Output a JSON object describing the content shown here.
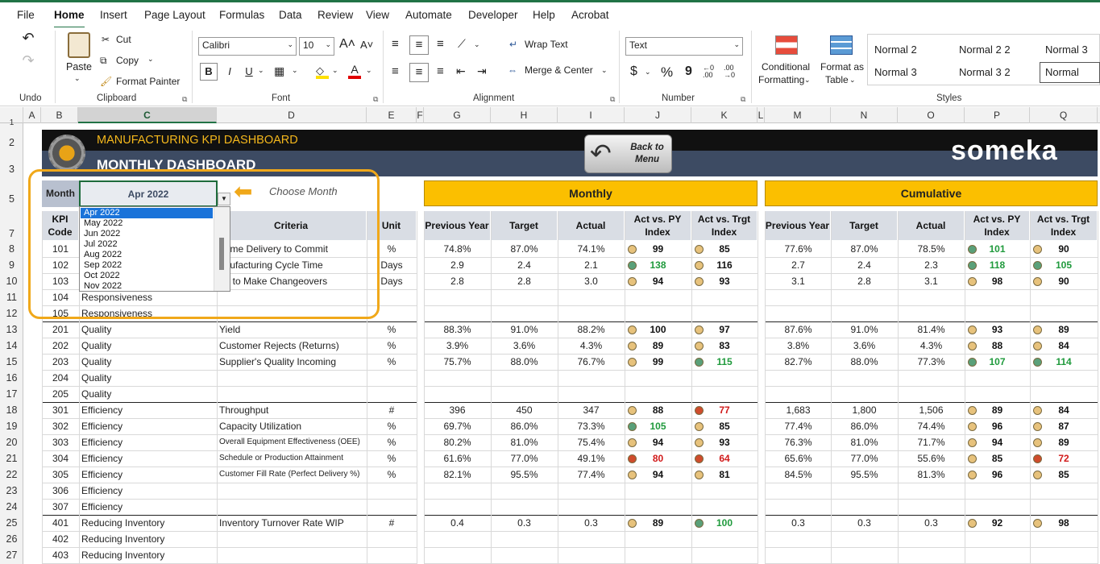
{
  "menu": {
    "items": [
      "File",
      "Home",
      "Insert",
      "Page Layout",
      "Formulas",
      "Data",
      "Review",
      "View",
      "Automate",
      "Developer",
      "Help",
      "Acrobat"
    ]
  },
  "ribbon": {
    "undo_group": "Undo",
    "clipboard": {
      "paste": "Paste",
      "cut": "Cut",
      "copy": "Copy",
      "format_painter": "Format Painter",
      "group": "Clipboard"
    },
    "font": {
      "family": "Calibri",
      "size": "10",
      "group": "Font",
      "bold": "B",
      "italic": "I",
      "underline": "U"
    },
    "alignment": {
      "wrap": "Wrap Text",
      "merge": "Merge & Center",
      "group": "Alignment"
    },
    "number": {
      "format": "Text",
      "currency": "$",
      "percent": "%",
      "comma": "9",
      "group": "Number"
    },
    "styles": {
      "conditional": "Conditional",
      "conditional2": "Formatting",
      "format_as": "Format as",
      "format_as2": "Table",
      "group": "Styles",
      "items": [
        "Normal 2",
        "Normal 2 2",
        "Normal 3",
        "Normal 3",
        "Normal 3 2",
        "Normal"
      ]
    }
  },
  "grid": {
    "columns": [
      "A",
      "B",
      "C",
      "D",
      "E",
      "F",
      "G",
      "H",
      "I",
      "J",
      "K",
      "L",
      "M",
      "N",
      "O",
      "P",
      "Q"
    ],
    "rows": [
      "1",
      "2",
      "3",
      "5",
      "7",
      "8",
      "9",
      "10",
      "11",
      "12",
      "13",
      "14",
      "15",
      "16",
      "17",
      "18",
      "19",
      "20",
      "21",
      "22",
      "23",
      "24",
      "25",
      "26",
      "27"
    ]
  },
  "dashboard": {
    "title": "MANUFACTURING KPI DASHBOARD",
    "subtitle": "MONTHLY DASHBOARD",
    "back_button": "Back to Menu",
    "brand": "someka",
    "month_label": "Month",
    "month_value": "Apr 2022",
    "choose_hint": "Choose Month",
    "dropdown_options": [
      "Apr 2022",
      "May 2022",
      "Jun 2022",
      "Jul 2022",
      "Aug 2022",
      "Sep 2022",
      "Oct 2022",
      "Nov 2022"
    ],
    "monthly_header": "Monthly",
    "cumulative_header": "Cumulative",
    "col_headers": {
      "kpi": "KPI Code",
      "criteria": "Criteria",
      "unit": "Unit",
      "prev": "Previous Year",
      "target": "Target",
      "actual": "Actual",
      "act_py": "Act vs. PY Index",
      "act_trgt": "Act vs. Trgt Index"
    },
    "status_colors": {
      "yellow": "#e7c27c",
      "green": "#5aa079",
      "red": "#cf4c2c",
      "green_text": "#1f9a3c",
      "red_text": "#d11a1a"
    },
    "rows": [
      {
        "code": "101",
        "category": "",
        "criteria": "-Time Delivery to Commit",
        "unit": "%",
        "m": [
          "74.8%",
          "87.0%",
          "74.1%"
        ],
        "mpy": [
          "y",
          "99"
        ],
        "mtg": [
          "y",
          "85"
        ],
        "c": [
          "77.6%",
          "87.0%",
          "78.5%"
        ],
        "cpy": [
          "g",
          "101"
        ],
        "ctg": [
          "y",
          "90"
        ]
      },
      {
        "code": "102",
        "category": "",
        "criteria": "anufacturing Cycle Time",
        "unit": "Days",
        "m": [
          "2.9",
          "2.4",
          "2.1"
        ],
        "mpy": [
          "g",
          "138"
        ],
        "mtg": [
          "y",
          "116"
        ],
        "c": [
          "2.7",
          "2.4",
          "2.3"
        ],
        "cpy": [
          "g",
          "118"
        ],
        "ctg": [
          "g",
          "105"
        ]
      },
      {
        "code": "103",
        "category": "",
        "criteria": "ne to Make Changeovers",
        "unit": "Days",
        "m": [
          "2.8",
          "2.8",
          "3.0"
        ],
        "mpy": [
          "y",
          "94"
        ],
        "mtg": [
          "y",
          "93"
        ],
        "c": [
          "3.1",
          "2.8",
          "3.1"
        ],
        "cpy": [
          "y",
          "98"
        ],
        "ctg": [
          "y",
          "90"
        ]
      },
      {
        "code": "104",
        "category": "Responsiveness",
        "criteria": "",
        "unit": "",
        "m": [
          "",
          "",
          ""
        ],
        "mpy": [
          "",
          ""
        ],
        "mtg": [
          "",
          ""
        ],
        "c": [
          "",
          "",
          ""
        ],
        "cpy": [
          "",
          ""
        ],
        "ctg": [
          "",
          ""
        ]
      },
      {
        "code": "105",
        "category": "Responsiveness",
        "criteria": "",
        "unit": "",
        "m": [
          "",
          "",
          ""
        ],
        "mpy": [
          "",
          ""
        ],
        "mtg": [
          "",
          ""
        ],
        "c": [
          "",
          "",
          ""
        ],
        "cpy": [
          "",
          ""
        ],
        "ctg": [
          "",
          ""
        ]
      },
      {
        "code": "201",
        "category": "Quality",
        "criteria": "Yield",
        "unit": "%",
        "m": [
          "88.3%",
          "91.0%",
          "88.2%"
        ],
        "mpy": [
          "y",
          "100"
        ],
        "mtg": [
          "y",
          "97"
        ],
        "c": [
          "87.6%",
          "91.0%",
          "81.4%"
        ],
        "cpy": [
          "y",
          "93"
        ],
        "ctg": [
          "y",
          "89"
        ]
      },
      {
        "code": "202",
        "category": "Quality",
        "criteria": "Customer Rejects (Returns)",
        "unit": "%",
        "m": [
          "3.9%",
          "3.6%",
          "4.3%"
        ],
        "mpy": [
          "y",
          "89"
        ],
        "mtg": [
          "y",
          "83"
        ],
        "c": [
          "3.8%",
          "3.6%",
          "4.3%"
        ],
        "cpy": [
          "y",
          "88"
        ],
        "ctg": [
          "y",
          "84"
        ]
      },
      {
        "code": "203",
        "category": "Quality",
        "criteria": "Supplier's Quality Incoming",
        "unit": "%",
        "m": [
          "75.7%",
          "88.0%",
          "76.7%"
        ],
        "mpy": [
          "y",
          "99"
        ],
        "mtg": [
          "g",
          "115"
        ],
        "c": [
          "82.7%",
          "88.0%",
          "77.3%"
        ],
        "cpy": [
          "g",
          "107"
        ],
        "ctg": [
          "g",
          "114"
        ]
      },
      {
        "code": "204",
        "category": "Quality",
        "criteria": "",
        "unit": "",
        "m": [
          "",
          "",
          ""
        ],
        "mpy": [
          "",
          ""
        ],
        "mtg": [
          "",
          ""
        ],
        "c": [
          "",
          "",
          ""
        ],
        "cpy": [
          "",
          ""
        ],
        "ctg": [
          "",
          ""
        ]
      },
      {
        "code": "205",
        "category": "Quality",
        "criteria": "",
        "unit": "",
        "m": [
          "",
          "",
          ""
        ],
        "mpy": [
          "",
          ""
        ],
        "mtg": [
          "",
          ""
        ],
        "c": [
          "",
          "",
          ""
        ],
        "cpy": [
          "",
          ""
        ],
        "ctg": [
          "",
          ""
        ]
      },
      {
        "code": "301",
        "category": "Efficiency",
        "criteria": "Throughput",
        "unit": "#",
        "m": [
          "396",
          "450",
          "347"
        ],
        "mpy": [
          "y",
          "88"
        ],
        "mtg": [
          "r",
          "77"
        ],
        "c": [
          "1,683",
          "1,800",
          "1,506"
        ],
        "cpy": [
          "y",
          "89"
        ],
        "ctg": [
          "y",
          "84"
        ]
      },
      {
        "code": "302",
        "category": "Efficiency",
        "criteria": "Capacity Utilization",
        "unit": "%",
        "m": [
          "69.7%",
          "86.0%",
          "73.3%"
        ],
        "mpy": [
          "g",
          "105"
        ],
        "mtg": [
          "y",
          "85"
        ],
        "c": [
          "77.4%",
          "86.0%",
          "74.4%"
        ],
        "cpy": [
          "y",
          "96"
        ],
        "ctg": [
          "y",
          "87"
        ]
      },
      {
        "code": "303",
        "category": "Efficiency",
        "criteria": "Overall Equipment Effectiveness (OEE)",
        "unit": "%",
        "m": [
          "80.2%",
          "81.0%",
          "75.4%"
        ],
        "mpy": [
          "y",
          "94"
        ],
        "mtg": [
          "y",
          "93"
        ],
        "c": [
          "76.3%",
          "81.0%",
          "71.7%"
        ],
        "cpy": [
          "y",
          "94"
        ],
        "ctg": [
          "y",
          "89"
        ]
      },
      {
        "code": "304",
        "category": "Efficiency",
        "criteria": "Schedule or Production Attainment",
        "unit": "%",
        "m": [
          "61.6%",
          "77.0%",
          "49.1%"
        ],
        "mpy": [
          "r",
          "80"
        ],
        "mtg": [
          "r",
          "64"
        ],
        "c": [
          "65.6%",
          "77.0%",
          "55.6%"
        ],
        "cpy": [
          "y",
          "85"
        ],
        "ctg": [
          "r",
          "72"
        ]
      },
      {
        "code": "305",
        "category": "Efficiency",
        "criteria": "Customer Fill Rate (Perfect Delivery %)",
        "unit": "%",
        "m": [
          "82.1%",
          "95.5%",
          "77.4%"
        ],
        "mpy": [
          "y",
          "94"
        ],
        "mtg": [
          "y",
          "81"
        ],
        "c": [
          "84.5%",
          "95.5%",
          "81.3%"
        ],
        "cpy": [
          "y",
          "96"
        ],
        "ctg": [
          "y",
          "85"
        ]
      },
      {
        "code": "306",
        "category": "Efficiency",
        "criteria": "",
        "unit": "",
        "m": [
          "",
          "",
          ""
        ],
        "mpy": [
          "",
          ""
        ],
        "mtg": [
          "",
          ""
        ],
        "c": [
          "",
          "",
          ""
        ],
        "cpy": [
          "",
          ""
        ],
        "ctg": [
          "",
          ""
        ]
      },
      {
        "code": "307",
        "category": "Efficiency",
        "criteria": "",
        "unit": "",
        "m": [
          "",
          "",
          ""
        ],
        "mpy": [
          "",
          ""
        ],
        "mtg": [
          "",
          ""
        ],
        "c": [
          "",
          "",
          ""
        ],
        "cpy": [
          "",
          ""
        ],
        "ctg": [
          "",
          ""
        ]
      },
      {
        "code": "401",
        "category": "Reducing Inventory",
        "criteria": "Inventory Turnover Rate WIP",
        "unit": "#",
        "m": [
          "0.4",
          "0.3",
          "0.3"
        ],
        "mpy": [
          "y",
          "89"
        ],
        "mtg": [
          "g",
          "100"
        ],
        "c": [
          "0.3",
          "0.3",
          "0.3"
        ],
        "cpy": [
          "y",
          "92"
        ],
        "ctg": [
          "y",
          "98"
        ]
      },
      {
        "code": "402",
        "category": "Reducing Inventory",
        "criteria": "",
        "unit": "",
        "m": [
          "",
          "",
          ""
        ],
        "mpy": [
          "",
          ""
        ],
        "mtg": [
          "",
          ""
        ],
        "c": [
          "",
          "",
          ""
        ],
        "cpy": [
          "",
          ""
        ],
        "ctg": [
          "",
          ""
        ]
      },
      {
        "code": "403",
        "category": "Reducing Inventory",
        "criteria": "",
        "unit": "",
        "m": [
          "",
          "",
          ""
        ],
        "mpy": [
          "",
          ""
        ],
        "mtg": [
          "",
          ""
        ],
        "c": [
          "",
          "",
          ""
        ],
        "cpy": [
          "",
          ""
        ],
        "ctg": [
          "",
          ""
        ]
      }
    ]
  }
}
